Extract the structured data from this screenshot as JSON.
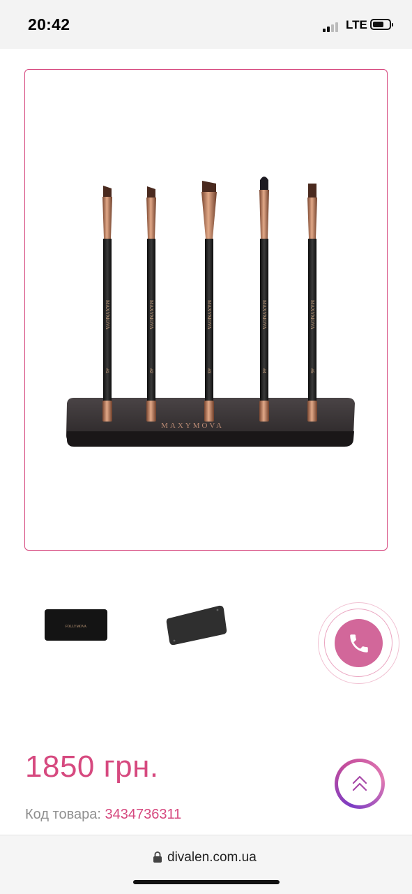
{
  "status_bar": {
    "time": "20:42",
    "network": "LTE",
    "icons": [
      "signal-icon",
      "battery-icon"
    ]
  },
  "product": {
    "image_name": "brush-set-with-magnetic-stand",
    "brand_mark": "MAXYMOVA",
    "brush_numbers": [
      "#1",
      "#2",
      "#3",
      "#4",
      "#5"
    ],
    "thumbnails": [
      "thumbnail-black-case",
      "thumbnail-black-plate"
    ],
    "thumbnail_logo": "FOLLYMOVA",
    "price": "1850 грн.",
    "sku_label": "Код товара:",
    "sku_value": "3434736311"
  },
  "actions": {
    "call_icon": "phone-icon",
    "scroll_top_icon": "chevron-double-up-icon"
  },
  "browser": {
    "url": "divalen.com.ua"
  },
  "colors": {
    "accent": "#d6497f",
    "call_button": "#d2679a",
    "rose_gold": "#c98a6e",
    "brush_handle": "#1c1c1c"
  }
}
